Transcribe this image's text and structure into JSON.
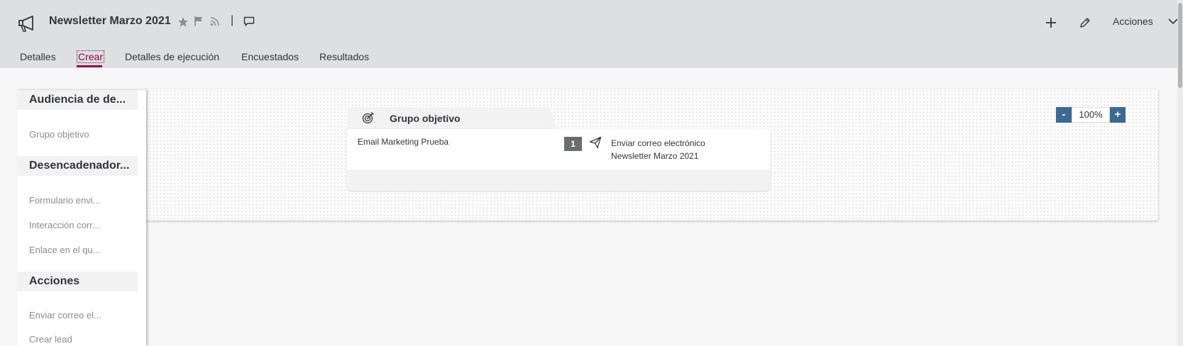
{
  "header": {
    "title": "Newsletter Marzo 2021",
    "separator": "|",
    "actions_label": "Acciones",
    "icons": [
      "megaphone-icon",
      "star-icon",
      "flag-icon",
      "rss-icon",
      "comment-icon",
      "add-icon",
      "edit-icon",
      "chevron-down-icon"
    ]
  },
  "tabs": [
    {
      "label": "Detalles"
    },
    {
      "label": "Crear",
      "active": true
    },
    {
      "label": "Detalles de ejecución"
    },
    {
      "label": "Encuestados"
    },
    {
      "label": "Resultados"
    }
  ],
  "palette": {
    "sections": [
      {
        "title": "Audiencia de de...",
        "items": [
          "Grupo objetivo"
        ]
      },
      {
        "title": "Desencadenador...",
        "items": [
          "Formulario envi...",
          "Interacción corr...",
          "Enlace en el qu..."
        ]
      },
      {
        "title": "Acciones",
        "items": [
          "Enviar correo el...",
          "Crear lead"
        ]
      }
    ]
  },
  "canvas": {
    "group": {
      "title": "Grupo objetivo",
      "name": "Email Marketing Prueba",
      "step": {
        "number": "1",
        "type": "Enviar correo electrónico",
        "name": "Newsletter Marzo 2021"
      }
    },
    "zoom": {
      "minus": "-",
      "value": "100%",
      "plus": "+"
    }
  },
  "colors": {
    "header_bg": "#dedfe3",
    "active_tab": "#a0004a",
    "zoom_button": "#3a6a94",
    "badge": "#6a6d70"
  }
}
